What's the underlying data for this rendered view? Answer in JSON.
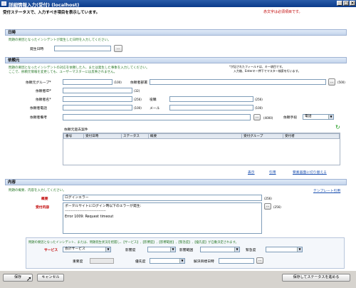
{
  "window": {
    "title": "詳細情報入力(受付) (localhost)"
  },
  "header": {
    "instruction": "受付ステータスで、入力すべき項目を表示しています。",
    "required_note": "赤文字は必須項目です。"
  },
  "date_section": {
    "title": "日時",
    "note": "問題の要因となったインシデントが発生した日時を入力してください。",
    "occurred_label": "発生日時",
    "occurred_value": "",
    "picker_label": "..."
  },
  "requester": {
    "title": "依頼元",
    "note1": "問題の要因となったインシデントの対応を依頼した人、または発生した事象を入力してください。",
    "note2": "ここで、依頼元情報を変更しても、ユーザーマスターには反映されません。",
    "help1": "*が記されたフィールドは、キー項目です。",
    "help2": "入力後、Enterキー押下でマスター検索を行います。",
    "group_label": "依頼元グループ*",
    "group_max": "(100)",
    "dept_label": "依頼者部署",
    "dept_max": "(500)",
    "id_label": "依頼者ID*",
    "id_max": "(32)",
    "name_label": "依頼者名*",
    "name_max": "(256)",
    "title_label": "役職",
    "title_max": "(256)",
    "phone_label": "依頼者電話",
    "phone_max": "(100)",
    "mail_label": "メール",
    "mail_max": "(100)",
    "remarks_label": "依頼者備考",
    "remarks_max": "(4000)",
    "method_label": "依頼手段",
    "method_value": "電話",
    "history_title": "依頼元過去案件",
    "history_cols": [
      "番号",
      "受付日時",
      "ステータス",
      "概要",
      "受付グループ",
      "受付者"
    ],
    "links": [
      "表示",
      "引用",
      "要素画面に切り替える"
    ]
  },
  "content": {
    "title": "内容",
    "note": "問題の概要、内容を入力してください。",
    "template_link": "テンプレート引用",
    "summary_label": "概要",
    "summary_value": "ログインエラー",
    "summary_max": "(256)",
    "detail_label": "受付内容",
    "detail_line1": "ポータルサイトにログイン時以下のエラーが発生:",
    "detail_line2": "----------------------------------------",
    "detail_line3": "Error 1009: Request timeout",
    "detail_max": "(256)"
  },
  "service": {
    "note": "問題の要因となったインシデント、または、問題発生状況を把握し、【サービス】,【影響度】,【影響範囲】,【緊急度】,【優先度】が自動決定されます。",
    "service_label": "サービス",
    "service_value": "会計サービス",
    "impact_label": "影響度",
    "scope_label": "影響範囲",
    "urgency_label": "緊急度",
    "severity_label": "重要度",
    "priority_label": "優先度",
    "deadline_label": "解決目標日時"
  },
  "footer": {
    "save": "保存",
    "cancel": "キャンセル",
    "save_advance": "保存してステータスを進める"
  }
}
